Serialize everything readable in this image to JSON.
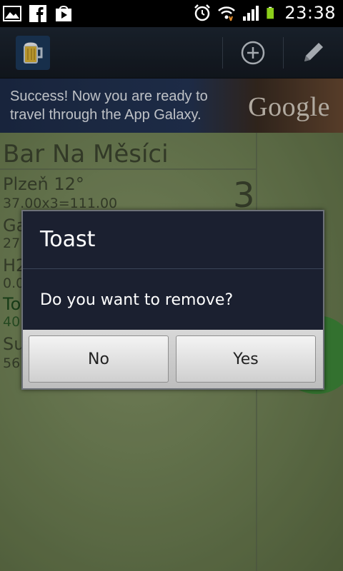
{
  "status_bar": {
    "time": "23:38",
    "left_icons": [
      "gallery-icon",
      "facebook-icon",
      "play-store-icon"
    ],
    "right_icons": [
      "alarm-icon",
      "wifi-icon",
      "signal-icon",
      "battery-icon"
    ]
  },
  "action_bar": {
    "app_icon": "beer-mug-icon",
    "actions": [
      "add-icon",
      "edit-pencil-icon"
    ]
  },
  "ad": {
    "text": "Success! Now you are ready to travel through the App Galaxy.",
    "brand": "Google"
  },
  "background": {
    "bar_name": "Bar Na Měsíci",
    "rows": [
      {
        "name": "Plzeň 12°",
        "detail": "37.00x3=111.00"
      },
      {
        "name": "Ga",
        "detail": "27"
      },
      {
        "name": "H2",
        "detail": "0.0"
      },
      {
        "name": "To",
        "detail": "40"
      },
      {
        "name": "Su",
        "detail": "56"
      }
    ],
    "count": "3"
  },
  "dialog": {
    "title": "Toast",
    "message": "Do you want to remove?",
    "no_label": "No",
    "yes_label": "Yes"
  },
  "colors": {
    "dialog_bg": "#1b2030",
    "action_bar_bg": "#1e2733",
    "content_bg": "#76885a",
    "accent_green": "#3f8a3a"
  }
}
